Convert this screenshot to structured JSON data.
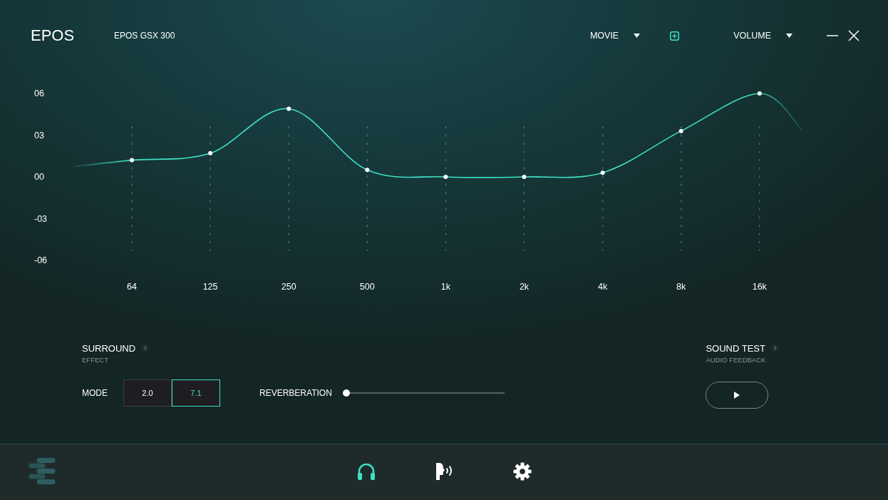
{
  "header": {
    "logo": "EPOS",
    "device": "EPOS GSX 300",
    "preset": "MOVIE",
    "output_menu": "VOLUME"
  },
  "equalizer": {
    "chart_data": {
      "type": "line",
      "categories": [
        "64",
        "125",
        "250",
        "500",
        "1k",
        "2k",
        "4k",
        "8k",
        "16k"
      ],
      "values": [
        1.2,
        1.7,
        4.9,
        0.5,
        0,
        0,
        0.3,
        3.3,
        6
      ],
      "ylim": [
        -6,
        6
      ],
      "grid": true,
      "marker": true,
      "yticks": [
        {
          "value": 6,
          "label": "06"
        },
        {
          "value": 3,
          "label": "03"
        },
        {
          "value": 0,
          "label": "00"
        },
        {
          "value": -3,
          "label": "-03"
        },
        {
          "value": -6,
          "label": "-06"
        }
      ]
    }
  },
  "surround": {
    "title": "SURROUND",
    "help": "?",
    "subtitle": "EFFECT",
    "mode_label": "MODE",
    "modes": [
      {
        "label": "2.0",
        "selected": false
      },
      {
        "label": "7.1",
        "selected": true
      }
    ],
    "reverb": {
      "label": "REVERBERATION",
      "level": 0
    }
  },
  "sound_test": {
    "title": "SOUND TEST",
    "help": "?",
    "subtitle": "AUDIO FEEDBACK"
  },
  "nav": [
    {
      "kind": "headphones",
      "selected": true
    },
    {
      "kind": "sidetone",
      "selected": false
    },
    {
      "kind": "settings",
      "selected": false
    }
  ]
}
